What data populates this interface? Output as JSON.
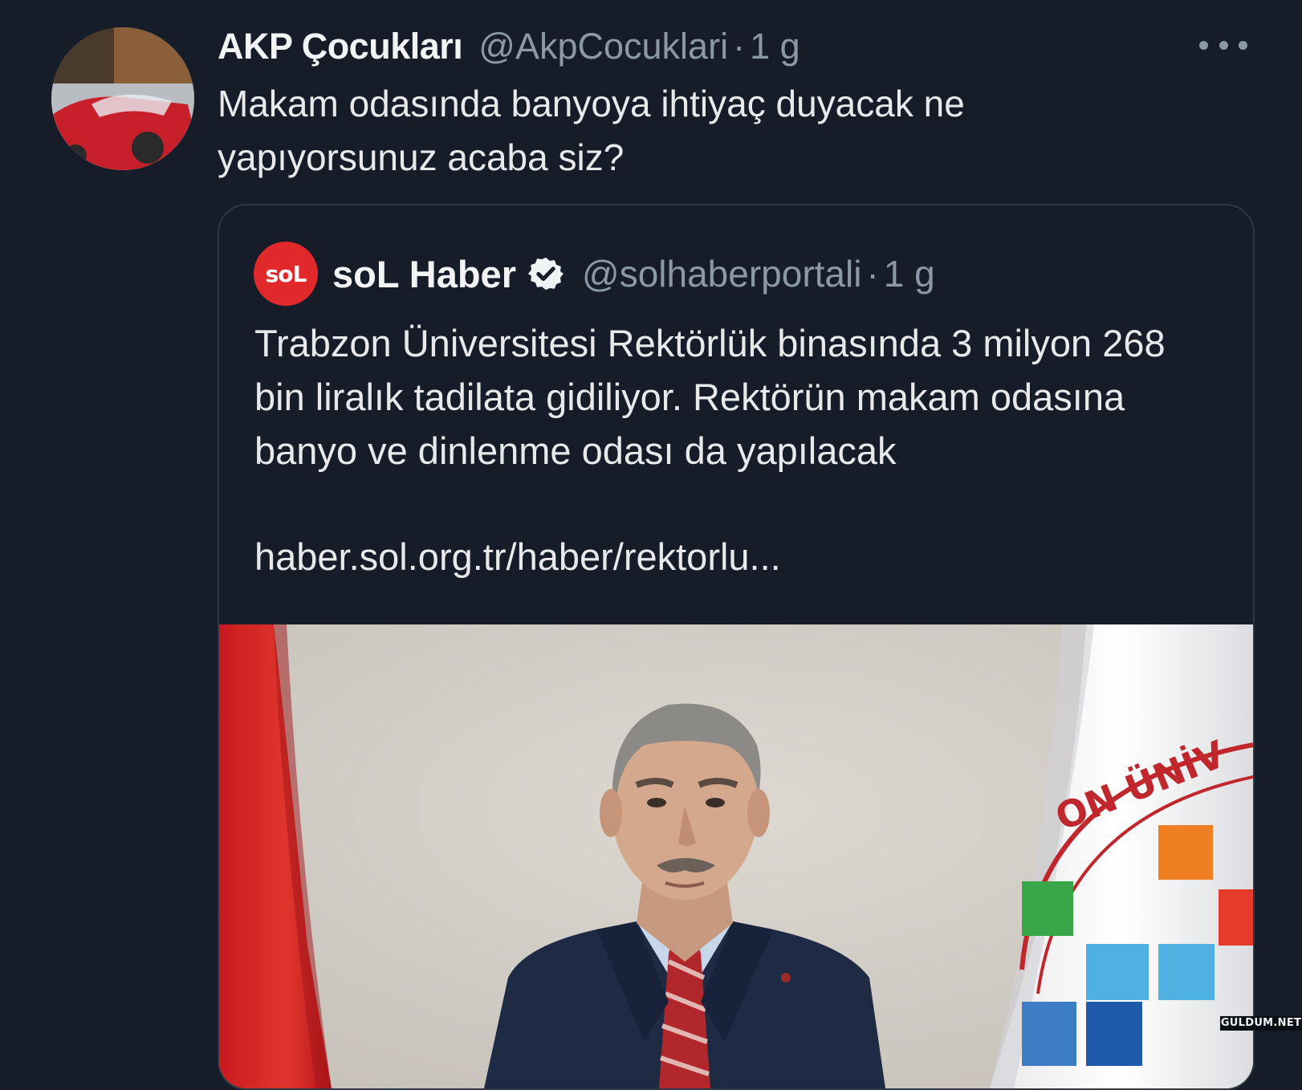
{
  "tweet": {
    "author_name": "AKP Çocukları",
    "author_handle": "@AkpCocuklari",
    "separator": "·",
    "time": "1 g",
    "text": "Makam odasında banyoya ihtiyaç duyacak ne yapıyorsunuz acaba siz?",
    "avatar_icon": "avatar-red-car",
    "more_icon": "more-horizontal-icon"
  },
  "quote": {
    "avatar_logo": "soL",
    "author_name": "soL Haber",
    "verified_icon": "verified-badge-icon",
    "author_handle": "@solhaberportali",
    "separator": "·",
    "time": "1 g",
    "text": "Trabzon Üniversitesi Rektörlük binasında 3 milyon 268 bin liralık tadilata gidiliyor. Rektörün makam odasına banyo ve dinlenme odası da yapılacak",
    "link": "haber.sol.org.tr/haber/rektorlu...",
    "image": {
      "description_icon": "portrait-photo",
      "seal_text": "ON ÜNİV"
    }
  },
  "watermark": "GULDUM.NET",
  "colors": {
    "background": "#161d29",
    "text": "#e7e9ea",
    "secondary_text": "#8b98a5",
    "card_border": "#2f3842",
    "sol_red": "#e1292b"
  }
}
